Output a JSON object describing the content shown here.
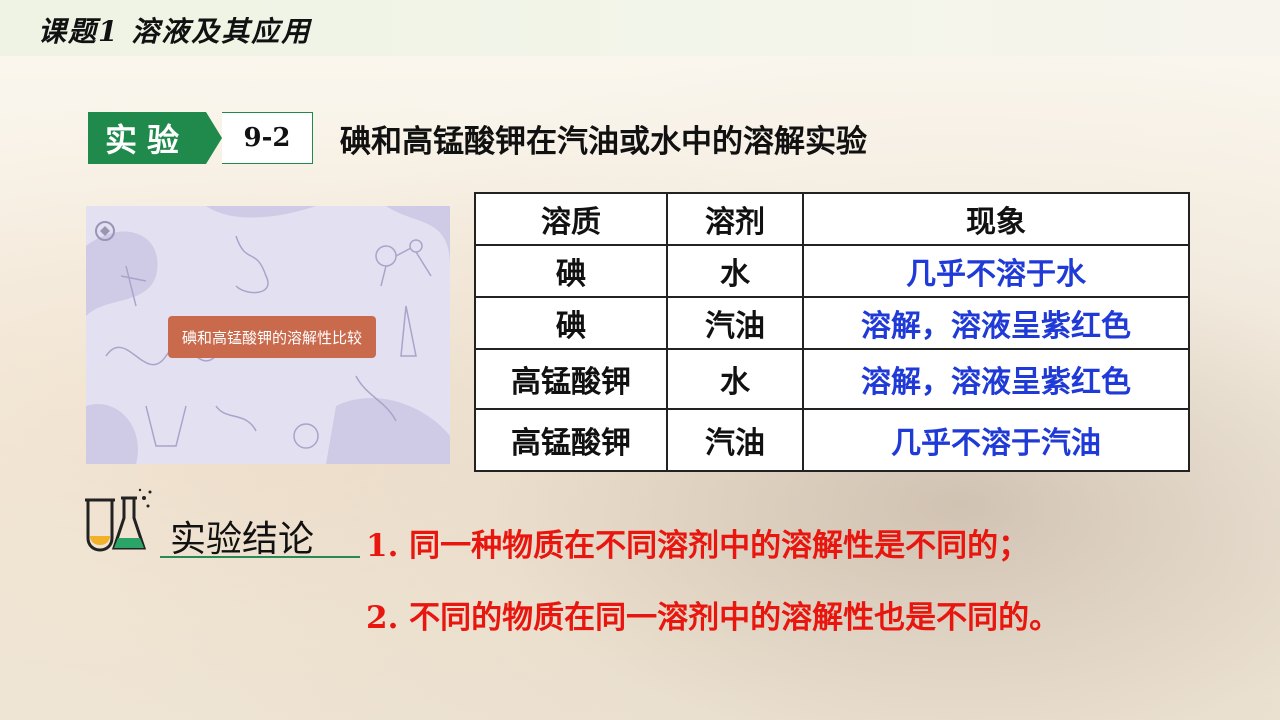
{
  "header": {
    "title": "课题1  溶液及其应用"
  },
  "experiment": {
    "tag": "实验",
    "number": "9-2",
    "title": "碘和高锰酸钾在汽油或水中的溶解实验"
  },
  "video": {
    "button_label": "碘和高锰酸钾的溶解性比较"
  },
  "table": {
    "headers": [
      "溶质",
      "溶剂",
      "现象"
    ],
    "rows": [
      [
        "碘",
        "水",
        "几乎不溶于水"
      ],
      [
        "碘",
        "汽油",
        "溶解，溶液呈紫红色"
      ],
      [
        "高锰酸钾",
        "水",
        "溶解，溶液呈紫红色"
      ],
      [
        "高锰酸钾",
        "汽油",
        "几乎不溶于汽油"
      ]
    ]
  },
  "conclusion": {
    "label": "实验结论",
    "items": [
      {
        "num": "1.",
        "text": "同一种物质在不同溶剂中的溶解性是不同的；"
      },
      {
        "num": "2.",
        "text": "不同的物质在同一溶剂中的溶解性也是不同的。"
      }
    ]
  },
  "colors": {
    "accent_green": "#1f8a4c",
    "phenomenon_blue": "#1f3ad6",
    "conclusion_red": "#e8160f"
  }
}
